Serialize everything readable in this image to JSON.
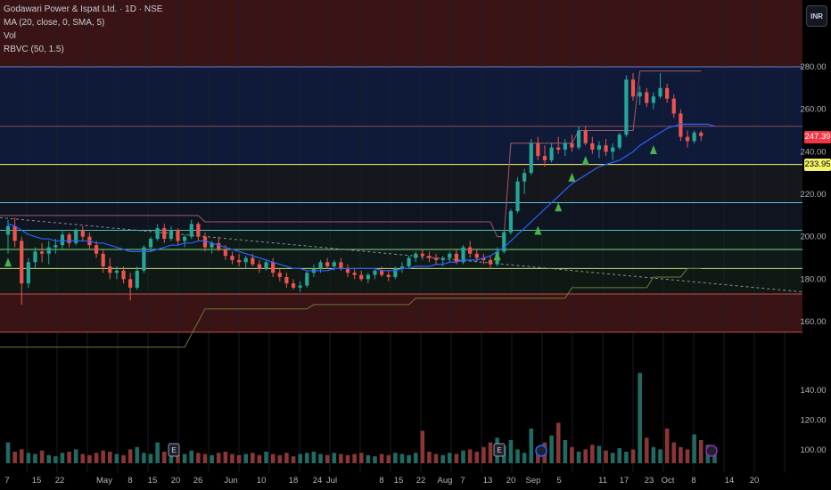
{
  "legend": {
    "symbol": "Godawari Power & Ispat Ltd. · 1D · NSE",
    "ma": "MA (20, close, 0, SMA, 5)",
    "vol": "Vol",
    "rbvc": "RBVC (50, 1.5)"
  },
  "currency": "INR",
  "price_tags": {
    "last": "247.39",
    "level": "233.95"
  },
  "colors": {
    "up": "#26a69a",
    "down": "#ef5350",
    "ma": "#2962ff",
    "grid": "#1a1d27",
    "zone_red": "#3a1414",
    "zone_blue": "#0f1a38",
    "yellow": "#f5f56a",
    "last_tag_bg": "#f23645",
    "level_tag_bg": "#f5f56a",
    "triangle": "#4caf50"
  },
  "chart_data": {
    "type": "candlestick",
    "price_axis": {
      "ticks": [
        280,
        260,
        240,
        220,
        200,
        180,
        160
      ],
      "ylim": [
        152,
        297
      ]
    },
    "volume_axis": {
      "ticks": [
        140,
        120,
        100
      ]
    },
    "x_labels": [
      "7",
      "15",
      "22",
      "May",
      "8",
      "15",
      "20",
      "26",
      "Jun",
      "10",
      "18",
      "24",
      "Jul",
      "8",
      "15",
      "22",
      "Aug",
      "7",
      "13",
      "20",
      "Sep",
      "5",
      "11",
      "17",
      "23",
      "Oct",
      "8",
      "14",
      "20"
    ],
    "candles": [
      {
        "o": 201,
        "h": 208,
        "l": 192,
        "c": 205
      },
      {
        "o": 205,
        "h": 209,
        "l": 195,
        "c": 198
      },
      {
        "o": 198,
        "h": 200,
        "l": 168,
        "c": 178
      },
      {
        "o": 178,
        "h": 190,
        "l": 176,
        "c": 188
      },
      {
        "o": 188,
        "h": 195,
        "l": 185,
        "c": 193
      },
      {
        "o": 193,
        "h": 197,
        "l": 188,
        "c": 192
      },
      {
        "o": 192,
        "h": 198,
        "l": 187,
        "c": 195
      },
      {
        "o": 195,
        "h": 199,
        "l": 192,
        "c": 196
      },
      {
        "o": 196,
        "h": 203,
        "l": 194,
        "c": 201
      },
      {
        "o": 201,
        "h": 202,
        "l": 195,
        "c": 197
      },
      {
        "o": 197,
        "h": 204,
        "l": 196,
        "c": 203
      },
      {
        "o": 203,
        "h": 205,
        "l": 198,
        "c": 200
      },
      {
        "o": 200,
        "h": 202,
        "l": 194,
        "c": 196
      },
      {
        "o": 196,
        "h": 198,
        "l": 190,
        "c": 192
      },
      {
        "o": 192,
        "h": 194,
        "l": 183,
        "c": 186
      },
      {
        "o": 186,
        "h": 190,
        "l": 180,
        "c": 183
      },
      {
        "o": 183,
        "h": 186,
        "l": 180,
        "c": 184
      },
      {
        "o": 184,
        "h": 186,
        "l": 178,
        "c": 180
      },
      {
        "o": 180,
        "h": 183,
        "l": 170,
        "c": 176
      },
      {
        "o": 176,
        "h": 186,
        "l": 175,
        "c": 184
      },
      {
        "o": 184,
        "h": 196,
        "l": 183,
        "c": 195
      },
      {
        "o": 195,
        "h": 200,
        "l": 193,
        "c": 199
      },
      {
        "o": 199,
        "h": 206,
        "l": 198,
        "c": 204
      },
      {
        "o": 204,
        "h": 206,
        "l": 197,
        "c": 199
      },
      {
        "o": 199,
        "h": 205,
        "l": 198,
        "c": 203
      },
      {
        "o": 203,
        "h": 204,
        "l": 196,
        "c": 198
      },
      {
        "o": 198,
        "h": 201,
        "l": 195,
        "c": 200
      },
      {
        "o": 200,
        "h": 208,
        "l": 199,
        "c": 206
      },
      {
        "o": 206,
        "h": 207,
        "l": 198,
        "c": 200
      },
      {
        "o": 200,
        "h": 202,
        "l": 193,
        "c": 195
      },
      {
        "o": 195,
        "h": 198,
        "l": 192,
        "c": 197
      },
      {
        "o": 197,
        "h": 200,
        "l": 193,
        "c": 194
      },
      {
        "o": 194,
        "h": 196,
        "l": 189,
        "c": 191
      },
      {
        "o": 191,
        "h": 193,
        "l": 187,
        "c": 189
      },
      {
        "o": 189,
        "h": 192,
        "l": 186,
        "c": 188
      },
      {
        "o": 188,
        "h": 191,
        "l": 185,
        "c": 190
      },
      {
        "o": 190,
        "h": 192,
        "l": 186,
        "c": 187
      },
      {
        "o": 187,
        "h": 189,
        "l": 183,
        "c": 185
      },
      {
        "o": 185,
        "h": 189,
        "l": 184,
        "c": 188
      },
      {
        "o": 188,
        "h": 190,
        "l": 181,
        "c": 183
      },
      {
        "o": 183,
        "h": 185,
        "l": 179,
        "c": 181
      },
      {
        "o": 181,
        "h": 183,
        "l": 176,
        "c": 178
      },
      {
        "o": 178,
        "h": 180,
        "l": 175,
        "c": 176
      },
      {
        "o": 176,
        "h": 179,
        "l": 174,
        "c": 177
      },
      {
        "o": 177,
        "h": 184,
        "l": 176,
        "c": 183
      },
      {
        "o": 183,
        "h": 187,
        "l": 181,
        "c": 185
      },
      {
        "o": 185,
        "h": 189,
        "l": 183,
        "c": 188
      },
      {
        "o": 188,
        "h": 190,
        "l": 185,
        "c": 186
      },
      {
        "o": 186,
        "h": 189,
        "l": 184,
        "c": 188
      },
      {
        "o": 188,
        "h": 190,
        "l": 184,
        "c": 185
      },
      {
        "o": 185,
        "h": 187,
        "l": 181,
        "c": 183
      },
      {
        "o": 183,
        "h": 185,
        "l": 180,
        "c": 182
      },
      {
        "o": 182,
        "h": 184,
        "l": 179,
        "c": 180
      },
      {
        "o": 180,
        "h": 183,
        "l": 178,
        "c": 182
      },
      {
        "o": 182,
        "h": 185,
        "l": 180,
        "c": 184
      },
      {
        "o": 184,
        "h": 186,
        "l": 181,
        "c": 182
      },
      {
        "o": 182,
        "h": 184,
        "l": 179,
        "c": 181
      },
      {
        "o": 181,
        "h": 186,
        "l": 180,
        "c": 185
      },
      {
        "o": 185,
        "h": 188,
        "l": 183,
        "c": 186
      },
      {
        "o": 186,
        "h": 191,
        "l": 185,
        "c": 190
      },
      {
        "o": 190,
        "h": 193,
        "l": 188,
        "c": 192
      },
      {
        "o": 192,
        "h": 194,
        "l": 189,
        "c": 191
      },
      {
        "o": 191,
        "h": 193,
        "l": 188,
        "c": 190
      },
      {
        "o": 190,
        "h": 192,
        "l": 187,
        "c": 189
      },
      {
        "o": 189,
        "h": 191,
        "l": 186,
        "c": 190
      },
      {
        "o": 190,
        "h": 193,
        "l": 188,
        "c": 192
      },
      {
        "o": 192,
        "h": 194,
        "l": 187,
        "c": 188
      },
      {
        "o": 188,
        "h": 196,
        "l": 187,
        "c": 195
      },
      {
        "o": 195,
        "h": 198,
        "l": 190,
        "c": 192
      },
      {
        "o": 192,
        "h": 194,
        "l": 188,
        "c": 190
      },
      {
        "o": 190,
        "h": 192,
        "l": 187,
        "c": 189
      },
      {
        "o": 189,
        "h": 191,
        "l": 185,
        "c": 187
      },
      {
        "o": 187,
        "h": 195,
        "l": 186,
        "c": 193
      },
      {
        "o": 193,
        "h": 203,
        "l": 192,
        "c": 202
      },
      {
        "o": 202,
        "h": 213,
        "l": 201,
        "c": 212
      },
      {
        "o": 212,
        "h": 228,
        "l": 211,
        "c": 226
      },
      {
        "o": 226,
        "h": 232,
        "l": 220,
        "c": 230
      },
      {
        "o": 230,
        "h": 246,
        "l": 229,
        "c": 244
      },
      {
        "o": 244,
        "h": 247,
        "l": 236,
        "c": 238
      },
      {
        "o": 238,
        "h": 243,
        "l": 233,
        "c": 236
      },
      {
        "o": 236,
        "h": 244,
        "l": 235,
        "c": 242
      },
      {
        "o": 242,
        "h": 247,
        "l": 239,
        "c": 241
      },
      {
        "o": 241,
        "h": 246,
        "l": 238,
        "c": 244
      },
      {
        "o": 244,
        "h": 248,
        "l": 240,
        "c": 242
      },
      {
        "o": 242,
        "h": 252,
        "l": 241,
        "c": 250
      },
      {
        "o": 250,
        "h": 252,
        "l": 243,
        "c": 244
      },
      {
        "o": 244,
        "h": 247,
        "l": 239,
        "c": 241
      },
      {
        "o": 241,
        "h": 245,
        "l": 237,
        "c": 243
      },
      {
        "o": 243,
        "h": 246,
        "l": 238,
        "c": 240
      },
      {
        "o": 240,
        "h": 244,
        "l": 236,
        "c": 242
      },
      {
        "o": 242,
        "h": 249,
        "l": 241,
        "c": 248
      },
      {
        "o": 248,
        "h": 276,
        "l": 247,
        "c": 274
      },
      {
        "o": 274,
        "h": 277,
        "l": 264,
        "c": 266
      },
      {
        "o": 266,
        "h": 271,
        "l": 262,
        "c": 268
      },
      {
        "o": 268,
        "h": 270,
        "l": 261,
        "c": 263
      },
      {
        "o": 263,
        "h": 268,
        "l": 260,
        "c": 266
      },
      {
        "o": 266,
        "h": 277,
        "l": 265,
        "c": 270
      },
      {
        "o": 270,
        "h": 272,
        "l": 263,
        "c": 265
      },
      {
        "o": 265,
        "h": 267,
        "l": 256,
        "c": 258
      },
      {
        "o": 258,
        "h": 260,
        "l": 245,
        "c": 247
      },
      {
        "o": 247,
        "h": 250,
        "l": 242,
        "c": 245
      },
      {
        "o": 245,
        "h": 250,
        "l": 244,
        "c": 249
      },
      {
        "o": 249,
        "h": 250,
        "l": 245,
        "c": 247.39
      }
    ],
    "volume": [
      18,
      10,
      12,
      9,
      8,
      11,
      7,
      6,
      9,
      10,
      12,
      8,
      7,
      9,
      11,
      10,
      8,
      7,
      12,
      14,
      9,
      8,
      18,
      10,
      9,
      7,
      8,
      11,
      9,
      8,
      7,
      9,
      10,
      8,
      7,
      8,
      9,
      7,
      10,
      8,
      7,
      9,
      6,
      8,
      9,
      10,
      8,
      7,
      9,
      8,
      7,
      8,
      9,
      7,
      6,
      8,
      7,
      9,
      8,
      7,
      9,
      28,
      10,
      8,
      7,
      9,
      8,
      11,
      12,
      10,
      14,
      18,
      22,
      15,
      20,
      12,
      9,
      30,
      14,
      18,
      24,
      35,
      20,
      14,
      10,
      12,
      16,
      15,
      11,
      9,
      13,
      10,
      12,
      78,
      22,
      14,
      12,
      30,
      18,
      14,
      12,
      25,
      20,
      16,
      14
    ],
    "ma20": [
      206,
      205,
      203,
      201,
      200,
      199,
      199,
      198,
      198,
      198,
      198,
      198,
      198,
      197,
      197,
      196,
      195,
      194,
      193,
      193,
      193,
      193,
      194,
      195,
      196,
      196,
      197,
      197,
      198,
      198,
      197,
      196,
      195,
      194,
      193,
      192,
      191,
      190,
      189,
      188,
      187,
      186,
      185,
      185,
      184,
      184,
      184,
      184,
      185,
      185,
      185,
      185,
      185,
      185,
      185,
      184,
      184,
      184,
      185,
      185,
      186,
      186,
      186,
      187,
      187,
      188,
      188,
      189,
      189,
      189,
      190,
      191,
      193,
      195,
      198,
      201,
      204,
      207,
      210,
      213,
      216,
      219,
      222,
      225,
      227,
      229,
      231,
      233,
      234,
      235,
      236,
      238,
      240,
      243,
      245,
      247,
      249,
      251,
      252,
      253,
      253,
      253,
      253,
      253,
      252
    ]
  }
}
